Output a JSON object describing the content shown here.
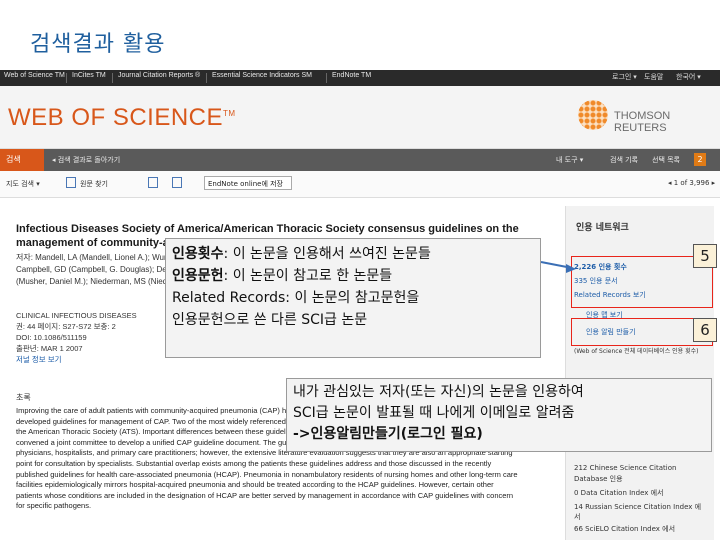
{
  "slide": {
    "title": "검색결과 활용"
  },
  "topnav": {
    "links": [
      "Web of Science TM",
      "InCites TM",
      "Journal Citation Reports ®",
      "Essential Science Indicators SM",
      "EndNote TM"
    ],
    "right": [
      "로그인 ▾",
      "도움말",
      "한국어 ▾"
    ]
  },
  "brand": {
    "logo": "WEB OF SCIENCE",
    "tm": "TM",
    "publisher": "THOMSON REUTERS"
  },
  "graybar": {
    "search_tab": "검색",
    "back": "◂ 검색 결과로 돌아가기",
    "tools": "내 도구 ▾",
    "history": "검색 기록",
    "marked_list": "선택 목록",
    "marked_count": "2"
  },
  "toolbar": {
    "full_text": "지도 검색 ▾",
    "find": "원문 찾기",
    "save_to": "EndNote online에 저장",
    "pager": "◂  1  of  3,996  ▸"
  },
  "record": {
    "title": "Infectious Diseases Society of America/American Thoracic Society consensus guidelines on the management of community-acquired pneumonia in adults",
    "authors_1": "저자: Mandell, LA (Mandell, Lionel A.); Wunderink, RG",
    "authors_2": "Campbell, GD (Campbell, G. Douglas); De...",
    "authors_3": "(Musher, Daniel M.); Niederman, MS (Niede...",
    "source": "CLINICAL INFECTIOUS DISEASES",
    "volume": "권: 44  페이지: S27-S72  보충: 2",
    "doi": "DOI: 10.1086/511159",
    "published": "출판년: MAR 1 2007",
    "journal_info": "저널 정보 보기",
    "abstract_head": "초록",
    "abstract_lines": [
      "Improving the care of adult patients with community-acquired pneumonia (CAP) has been",
      "developed guidelines for management of CAP. Two of the most widely referenced are those",
      "the American Thoracic Society (ATS). Important differences between these guidelines",
      "convened a joint committee to develop a unified CAP guideline document. The guidelines are intended primarily for use by emergency medicine",
      "physicians, hospitalists, and primary care practitioners; however, the extensive literature evaluation suggests that they are also an appropriate starting",
      "point for consultation by specialists. Substantial overlap exists among the patients these guidelines address and those discussed in the recently",
      "published guidelines for health care-associated pneumonia (HCAP). Pneumonia in nonambulatory residents of nursing homes and other long-term care",
      "facilities epidemiologically mirrors hospital-acquired pneumonia and should be treated according to the HCAP guidelines. However, certain other",
      "patients whose conditions are included in the designation of HCAP are better served by management in accordance with CAP guidelines with concern",
      "for specific pathogens."
    ]
  },
  "sidebar": {
    "title": "인용 네트워크",
    "cited_count": "2,226 인용 횟수",
    "cited_refs": "335 인용 문서",
    "related": "Related Records 보기",
    "citation_map": "인용 맵 보기",
    "create_alert": "인용 알림 만들기",
    "alert_note": "(Web of Science 전체 데이터베이스 인용 횟수)",
    "db_lines": [
      "212 Chinese Science Citation",
      "Database 인용",
      "0 Data Citation Index 에서",
      "14 Russian Science Citation Index 에",
      "서",
      "66 SciELO Citation Index 에서"
    ]
  },
  "callouts": {
    "c1_label1": "인용횟수",
    "c1_text1": ": 이 논문을 인용해서 쓰여진 논문들",
    "c1_label2": "인용문헌",
    "c1_text2": ": 이 논문이 참고로 한 논문들",
    "c1_label3": "Related Records",
    "c1_text3": ": 이 논문의 참고문헌을",
    "c1_line4": "인용문헌으로 쓴 다른 SCI급 논문",
    "c2_line1": "내가 관심있는 저자(또는 자신)의 논문을 인용하여",
    "c2_line2": "SCI급 논문이 발표될 때 나에게 이메일로 알려줌",
    "c2_line3": "->인용알림만들기(로그인 필요)",
    "num5": "5",
    "num6": "6"
  }
}
